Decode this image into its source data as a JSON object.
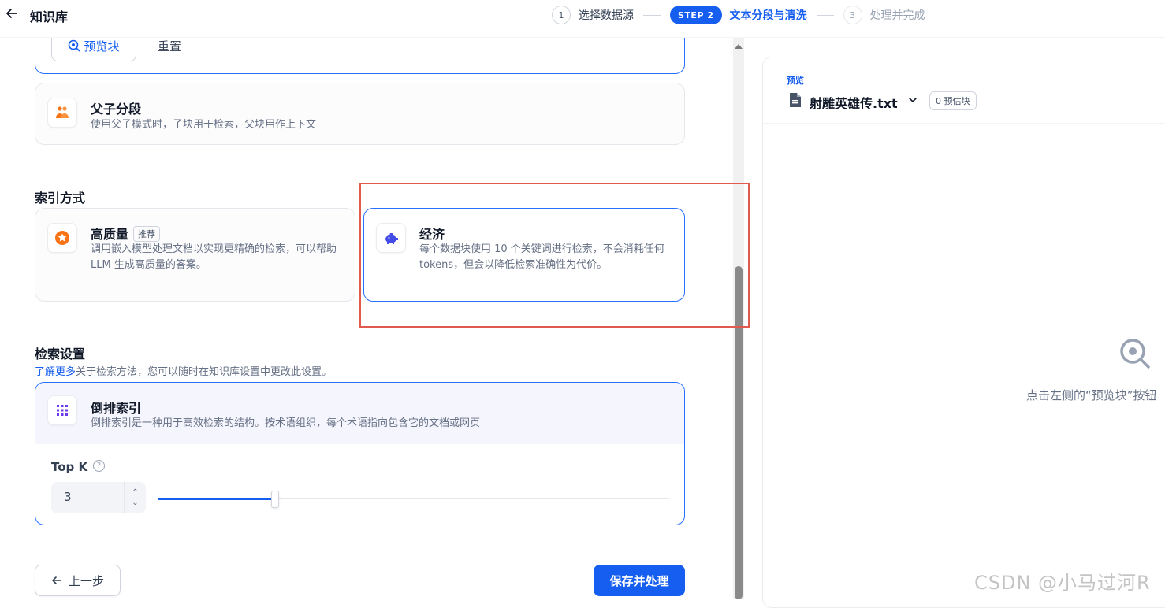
{
  "header": {
    "title": "知识库",
    "steps": [
      {
        "num": "1",
        "label": "选择数据源"
      },
      {
        "pill": "STEP 2",
        "label": "文本分段与清洗"
      },
      {
        "num": "3",
        "label": "处理并完成"
      }
    ]
  },
  "segment": {
    "preview_btn": "预览块",
    "reset_btn": "重置",
    "parent_child": {
      "title": "父子分段",
      "desc": "使用父子模式时，子块用于检索，父块用作上下文"
    }
  },
  "index": {
    "title": "索引方式",
    "high_quality": {
      "title": "高质量",
      "tag": "推荐",
      "desc": "调用嵌入模型处理文档以实现更精确的检索，可以帮助 LLM 生成高质量的答案。"
    },
    "economy": {
      "title": "经济",
      "desc": "每个数据块使用 10 个关键词进行检索，不会消耗任何 tokens，但会以降低检索准确性为代价。"
    }
  },
  "retrieval": {
    "title": "检索设置",
    "learn_more": "了解更多",
    "learn_more_suffix": "关于检索方法，您可以随时在知识库设置中更改此设置。",
    "method": {
      "title": "倒排索引",
      "desc": "倒排索引是一种用于高效检索的结构。按术语组织，每个术语指向包含它的文档或网页"
    },
    "topk_label": "Top K",
    "topk_value": "3",
    "slider_fraction": 0.23
  },
  "footer": {
    "prev_btn": "上一步",
    "save_btn": "保存并处理"
  },
  "preview": {
    "kicker": "预览",
    "file_name": "射雕英雄传.txt",
    "chunk_count": "0 预估块",
    "empty_text": "点击左侧的“预览块”按钮"
  },
  "watermark": "CSDN @小马过河R",
  "colors": {
    "accent": "#155eef",
    "annotation": "#e05a4f"
  }
}
